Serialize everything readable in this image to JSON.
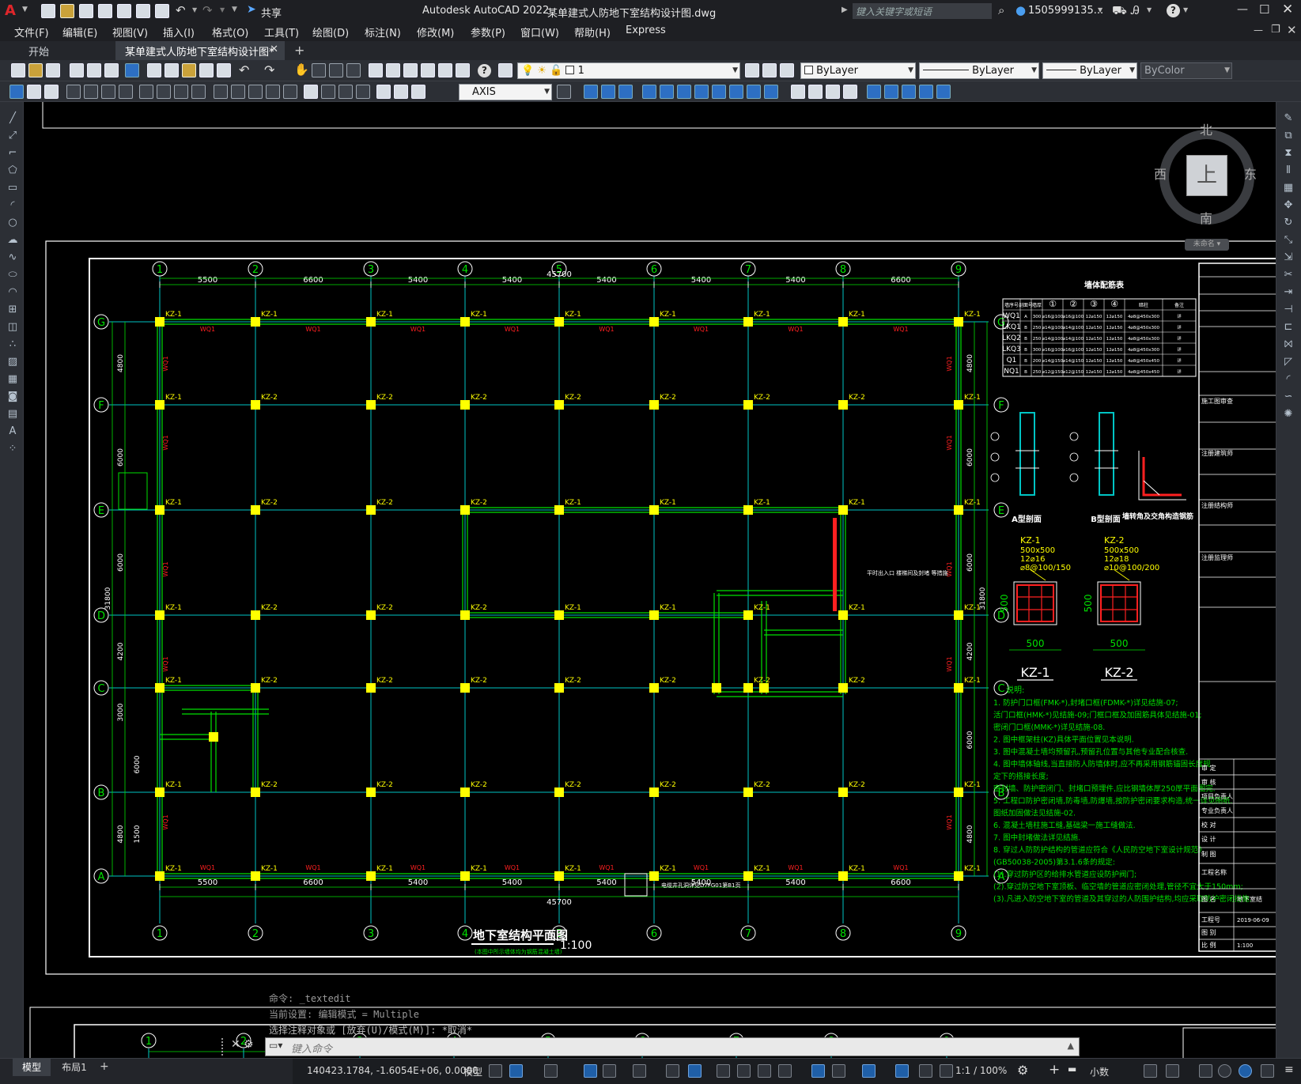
{
  "window": {
    "app_name": "Autodesk AutoCAD 2022",
    "file_title": "某单建式人防地下室结构设计图.dwg",
    "share_label": "共享",
    "search_placeholder": "键入关键字或短语",
    "user_name": "1505999135..."
  },
  "menu": [
    "文件(F)",
    "编辑(E)",
    "视图(V)",
    "插入(I)",
    "格式(O)",
    "工具(T)",
    "绘图(D)",
    "标注(N)",
    "修改(M)",
    "参数(P)",
    "窗口(W)",
    "帮助(H)",
    "Express"
  ],
  "tabs": [
    {
      "label": "开始"
    },
    {
      "label": "某单建式人防地下室结构设计图*"
    }
  ],
  "toolbar": {
    "layer_value": "1",
    "color_value": "ByLayer",
    "linetype_value": "ByLayer",
    "lineweight_value": "ByLayer",
    "plotstyle_value": "ByColor",
    "textstyle_value": "AXIS"
  },
  "viewcube": {
    "north": "北",
    "south": "南",
    "east": "东",
    "west": "西",
    "top": "上",
    "wcs": "未命名"
  },
  "drawing": {
    "title": "地下室结构平面图",
    "scale": "1:100",
    "subtitle": "(本图中所示墙体均为钢筋混凝土墙)",
    "axes_x": [
      "1",
      "2",
      "3",
      "4",
      "5",
      "6",
      "7",
      "8",
      "9"
    ],
    "axes_y": [
      "G",
      "F",
      "E",
      "D",
      "C",
      "B",
      "A"
    ],
    "dims_x": [
      "5500",
      "6600",
      "5400",
      "5400",
      "5400",
      "5400",
      "5400",
      "6600"
    ],
    "total_x": "45700",
    "dims_y_left": [
      "4800",
      "6000",
      "6000",
      "4200",
      "3000",
      "6000",
      "1500",
      "4800"
    ],
    "total_y": "31800",
    "dims_y_right": [
      "4800",
      "6000",
      "6000",
      "4200",
      "6000",
      "4800"
    ],
    "col_label_a": "KZ-1",
    "col_label_b": "KZ-2",
    "wall_label": "WQ1",
    "table": {
      "title": "墙体配筋表",
      "headers": [
        "墙序号",
        "剖面号",
        "墙厚",
        "①",
        "②",
        "③",
        "④",
        "暗柱",
        "备注"
      ],
      "rows": [
        [
          "WQ1",
          "A",
          "300",
          "⌀16@100",
          "⌀16@100",
          "12⌀150",
          "12⌀150",
          "4⌀8@450x300",
          "详"
        ],
        [
          "LKQ1",
          "B",
          "250",
          "⌀14@100",
          "⌀14@100",
          "12⌀150",
          "12⌀150",
          "4⌀8@450x300",
          "详"
        ],
        [
          "LKQ2",
          "B",
          "250",
          "⌀14@100",
          "⌀14@100",
          "12⌀150",
          "12⌀150",
          "4⌀8@450x300",
          "详"
        ],
        [
          "LKQ3",
          "B",
          "300",
          "⌀16@100",
          "⌀16@100",
          "12⌀150",
          "12⌀150",
          "4⌀8@450x300",
          "详"
        ],
        [
          "Q1",
          "B",
          "200",
          "⌀14@150",
          "⌀14@150",
          "12⌀150",
          "12⌀150",
          "4⌀8@450x450",
          "详"
        ],
        [
          "NQ1",
          "B",
          "250",
          "⌀12@150",
          "⌀12@150",
          "12⌀150",
          "12⌀150",
          "4⌀8@450x450",
          "详"
        ]
      ]
    },
    "section_a": "A型剖面",
    "section_b": "B型剖面",
    "section_corner": "墙转角及交角构造钢筋",
    "kz1": {
      "name": "KZ-1",
      "lines": [
        "500x500",
        "12⌀16",
        "⌀8@100/150"
      ],
      "dim": "500"
    },
    "kz2": {
      "name": "KZ-2",
      "lines": [
        "500x500",
        "12⌀18",
        "⌀10@100/200"
      ],
      "dim": "500"
    },
    "notes_title": "说明:",
    "notes": [
      "1. 防护门口框(FMK-*),封堵口框(FDMK-*)详见结施-07;",
      "   活门口框(HMK-*)见结施-09;门框口框及加固筋具体见结施-01;",
      "   密闭门口框(MMK-*)详见结施-08.",
      "2. 图中框架柱(KZ)具体平面位置见本说明.",
      "3. 图中混凝土墙均预留孔,预留孔位置与其他专业配合核查.",
      "4. 图中墙体轴线,当直接防人防墙体时,应不再采用钢筋锚固长度规",
      "   定下的搭接长度;",
      "   密封墙、防护密闭门、封堵口预埋件,应比钢墙体厚250厚平面图完.",
      "5. 工程口防护密闭墙,防毒墙,防爆墙,按防护密闭要求构造,统一详见图纸.",
      "   图纸加固做法见结施-02.",
      "6. 混凝土墙柱施工缝,基础梁一施工缝做法.",
      "7. 图中封堵做法详见结施.",
      "8. 穿过人防防护结构的管道应符合《人民防空地下室设计规范》",
      "   (GB50038-2005)第3.1.6条的规定:",
      "   (1).穿过防护区的给排水管道应设防护阀门;",
      "   (2).穿过防空地下室顶板、临空墙的管道应密闭处理,管径不宜大于150mm;",
      "   (3).凡进入防空地下室的管道及其穿过的人防围护结构,均应采取防护密闭措施."
    ],
    "titleblock": [
      "审 定",
      "审 核",
      "项目负责人",
      "专业负责人",
      "校 对",
      "设 计",
      "制 图",
      "工程名称",
      "图 名",
      "工程号",
      "图 别",
      "比 例"
    ],
    "titleblock_values": {
      "图名": "地下室结",
      "工程号": "2019-06-09",
      "比例": "1:100"
    },
    "titleblock_side": [
      "施工图审查",
      "注册建筑师",
      "注册结构师",
      "注册监理师"
    ],
    "lower_axes": [
      "1",
      "2",
      "3",
      "4",
      "5",
      "6",
      "7",
      "8",
      "9"
    ],
    "lower_total": "45700",
    "opening_note": "电缆井孔洞详见D7FG01第B1页",
    "wall_note": "平时出入口\n楼梯间及封堵\n等措施"
  },
  "command": {
    "history": [
      "命令: _textedit",
      "当前设置: 编辑模式 = Multiple",
      "选择注释对象或 [放弃(U)/模式(M)]: *取消*"
    ],
    "placeholder": "键入命令"
  },
  "status": {
    "layout_tabs": [
      "模型",
      "布局1"
    ],
    "coords": "140423.1784, -1.6054E+06, 0.0000",
    "mode": "模型",
    "anno_scale": "1:1 / 100%",
    "units": "小数"
  },
  "colors": {
    "grid": "#00c4c4",
    "wall": "#00e000",
    "column": "#ffff00",
    "label_red": "#ff2020",
    "accent": "#2d6fc3"
  }
}
